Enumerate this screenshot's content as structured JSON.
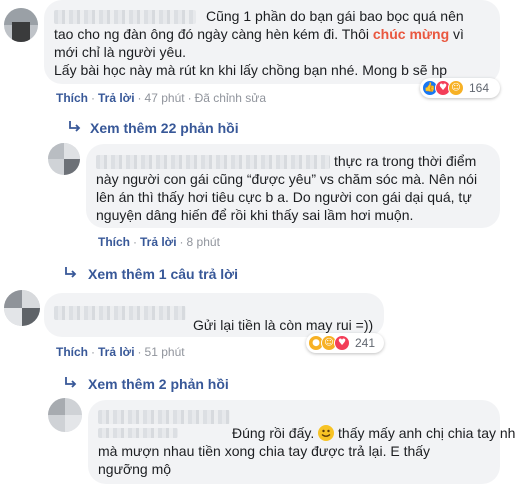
{
  "comments": [
    {
      "text_lines": [
        "Cũng 1 phần do bạn gái bao bọc quá nên",
        "tao cho ng đàn ông đó ngày càng hèn kém đi. Thôi ",
        "chúc mừng",
        " vì",
        "mới chỉ là người yêu.",
        "Lấy bài học này mà rút kn khi lấy chồng bạn nhé. Mong b sẽ hp"
      ],
      "actions": {
        "like": "Thích",
        "reply": "Trả lời",
        "time": "47 phút",
        "edited": "Đã chỉnh sửa"
      },
      "reaction_count": "164",
      "reaction_icons": [
        "like-icon",
        "love-icon",
        "haha-icon"
      ],
      "view_more": "Xem thêm 22 phản hồi"
    },
    {
      "text_lines": [
        "thực ra trong thời điểm",
        "này người con gái cũng “được yêu” vs chăm sóc mà. Nên nói",
        "lên án thì thấy hơi tiêu cực b a. Do người con gái dại quá, tự",
        "nguyện dâng hiến để rồi khi thấy sai lầm hơi muộn."
      ],
      "actions": {
        "like": "Thích",
        "reply": "Trả lời",
        "time": "8 phút"
      },
      "view_more": "Xem thêm 1 câu trả lời"
    },
    {
      "text_lines": [
        "Gửi lại tiền là còn may rui =))"
      ],
      "actions": {
        "like": "Thích",
        "reply": "Trả lời",
        "time": "51 phút"
      },
      "reaction_count": "241",
      "reaction_icons": [
        "wow-icon",
        "haha-icon",
        "love-icon"
      ],
      "view_more": "Xem thêm 2 phản hồi"
    },
    {
      "text_lines": [
        "Đúng rồi đấy. ",
        " thấy mấy anh chị chia tay nhau",
        "mà mượn nhau tiền xong chia tay được trả lại. E thấy",
        "ngưỡng mộ"
      ],
      "emoji": "smile-emoji"
    }
  ],
  "colors": {
    "link": "#385898",
    "meta": "#90949c",
    "bubble": "#f2f3f5",
    "highlight": "#e9573f"
  }
}
